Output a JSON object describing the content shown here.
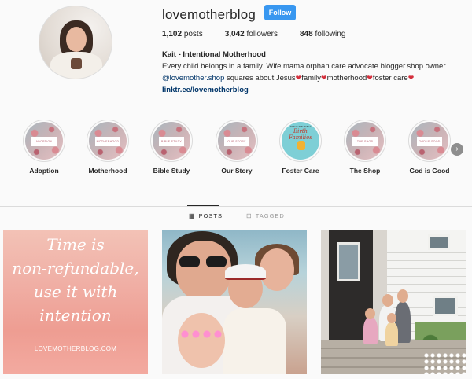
{
  "profile": {
    "username": "lovemotherblog",
    "follow_label": "Follow",
    "stats": {
      "posts_count": "1,102",
      "posts_label": "posts",
      "followers_count": "3,042",
      "followers_label": "followers",
      "following_count": "848",
      "following_label": "following"
    },
    "bio": {
      "name": "Kait - Intentional Motherhood",
      "line1": "Every child belongs in a family. Wife.mama.orphan care advocate.blogger.shop owner",
      "mention": "@lovemother.shop",
      "line2_parts": [
        " squares about Jesus",
        "family",
        "motherhood",
        "foster care"
      ],
      "link": "linktr.ee/lovemotherblog"
    }
  },
  "highlights": [
    {
      "label": "Adoption",
      "cover_text": "ADOPTION"
    },
    {
      "label": "Motherhood",
      "cover_text": "MOTHERHOOD"
    },
    {
      "label": "Bible Study",
      "cover_text": "BIBLE STUDY"
    },
    {
      "label": "Our Story",
      "cover_text": "OUR STORY"
    },
    {
      "label": "Foster Care",
      "cover_text": "Birth Families",
      "cover_top": "AT THE THE TABLE"
    },
    {
      "label": "The Shop",
      "cover_text": "THE SHOP"
    },
    {
      "label": "God is Good",
      "cover_text": "GOD IS GOOD"
    }
  ],
  "tabs": {
    "posts": "POSTS",
    "tagged": "TAGGED"
  },
  "posts": {
    "quote_lines": [
      "Time is",
      "non-refundable,",
      "use it with",
      "intention"
    ],
    "quote_site": "LOVEMOTHERBLOG.COM"
  },
  "icons": {
    "posts_tab": "grid-icon",
    "tagged_tab": "tag-icon",
    "next": "chevron-right-icon",
    "heart": "red-heart-icon"
  },
  "colors": {
    "follow_button": "#3897f0",
    "link": "#003569",
    "heart": "#d42f3c"
  }
}
